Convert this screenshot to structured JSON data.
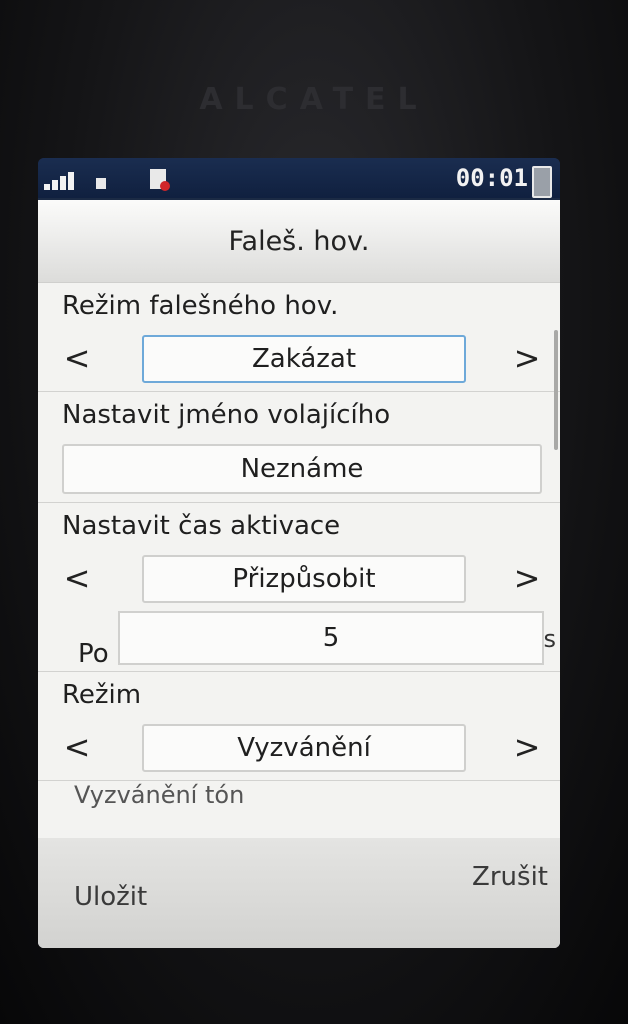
{
  "device": {
    "brand": "ALCATEL"
  },
  "status_bar": {
    "time": "00:01"
  },
  "screen": {
    "title": "Faleš. hov.",
    "fake_call_mode": {
      "label": "Režim falešného hov.",
      "value": "Zakázat",
      "prev": "<",
      "next": ">"
    },
    "caller_name": {
      "label": "Nastavit jméno volajícího",
      "value": "Neznáme"
    },
    "activation_time": {
      "label": "Nastavit čas aktivace",
      "value": "Přizpůsobit",
      "prev": "<",
      "next": ">"
    },
    "after": {
      "prefix": "Po",
      "value": "5",
      "unit": "s"
    },
    "mode": {
      "label": "Režim",
      "value": "Vyzvánění",
      "prev": "<",
      "next": ">"
    },
    "ringtone_peek": "Vyzvánění tón"
  },
  "softkeys": {
    "left": "Uložit",
    "right": "Zrušit"
  }
}
